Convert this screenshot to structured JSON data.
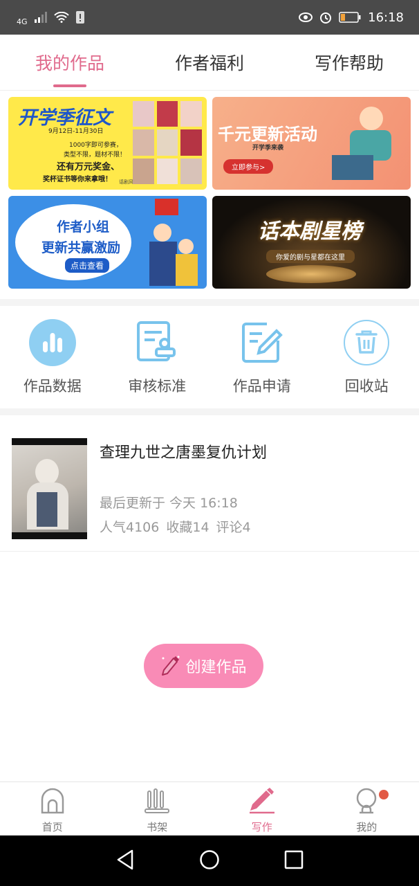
{
  "status_bar": {
    "network": "4G",
    "time": "16:18"
  },
  "tabs": [
    {
      "label": "我的作品",
      "active": true
    },
    {
      "label": "作者福利",
      "active": false
    },
    {
      "label": "写作帮助",
      "active": false
    }
  ],
  "banners": [
    {
      "title": "开学季征文",
      "dates": "9月12日-11月30日",
      "line1": "1000字即可参赛，",
      "line2": "类型不限，题材不限！",
      "line3": "还有万元奖金、",
      "line4": "奖杯证书等你来拿哦！",
      "brand": "话剧风暴"
    },
    {
      "title": "千元更新活动",
      "subtitle": "开学季来袭",
      "button": "立即参与>"
    },
    {
      "title1": "作者小组",
      "title2": "更新共赢激励",
      "button": "点击查看"
    },
    {
      "title": "话本剧星榜",
      "subtitle": "你爱的剧与星都在这里"
    }
  ],
  "tools": [
    {
      "label": "作品数据",
      "icon": "bar-chart-icon"
    },
    {
      "label": "审核标准",
      "icon": "review-stamp-icon"
    },
    {
      "label": "作品申请",
      "icon": "edit-document-icon"
    },
    {
      "label": "回收站",
      "icon": "trash-icon"
    }
  ],
  "work": {
    "title": "查理九世之唐墨复仇计划",
    "updated": "最后更新于 今天 16:18",
    "popularity": "人气4106",
    "favorites": "收藏14",
    "comments": "评论4"
  },
  "create_button": {
    "label": "创建作品"
  },
  "bottom_nav": [
    {
      "label": "首页",
      "icon": "home-icon"
    },
    {
      "label": "书架",
      "icon": "bookshelf-icon"
    },
    {
      "label": "写作",
      "icon": "pencil-icon",
      "active": true
    },
    {
      "label": "我的",
      "icon": "profile-icon",
      "has_badge": true
    }
  ],
  "colors": {
    "accent": "#e06a8c",
    "button": "#f98bb6",
    "icon_blue": "#78c3ec",
    "status_bar": "#4a4a4a"
  }
}
